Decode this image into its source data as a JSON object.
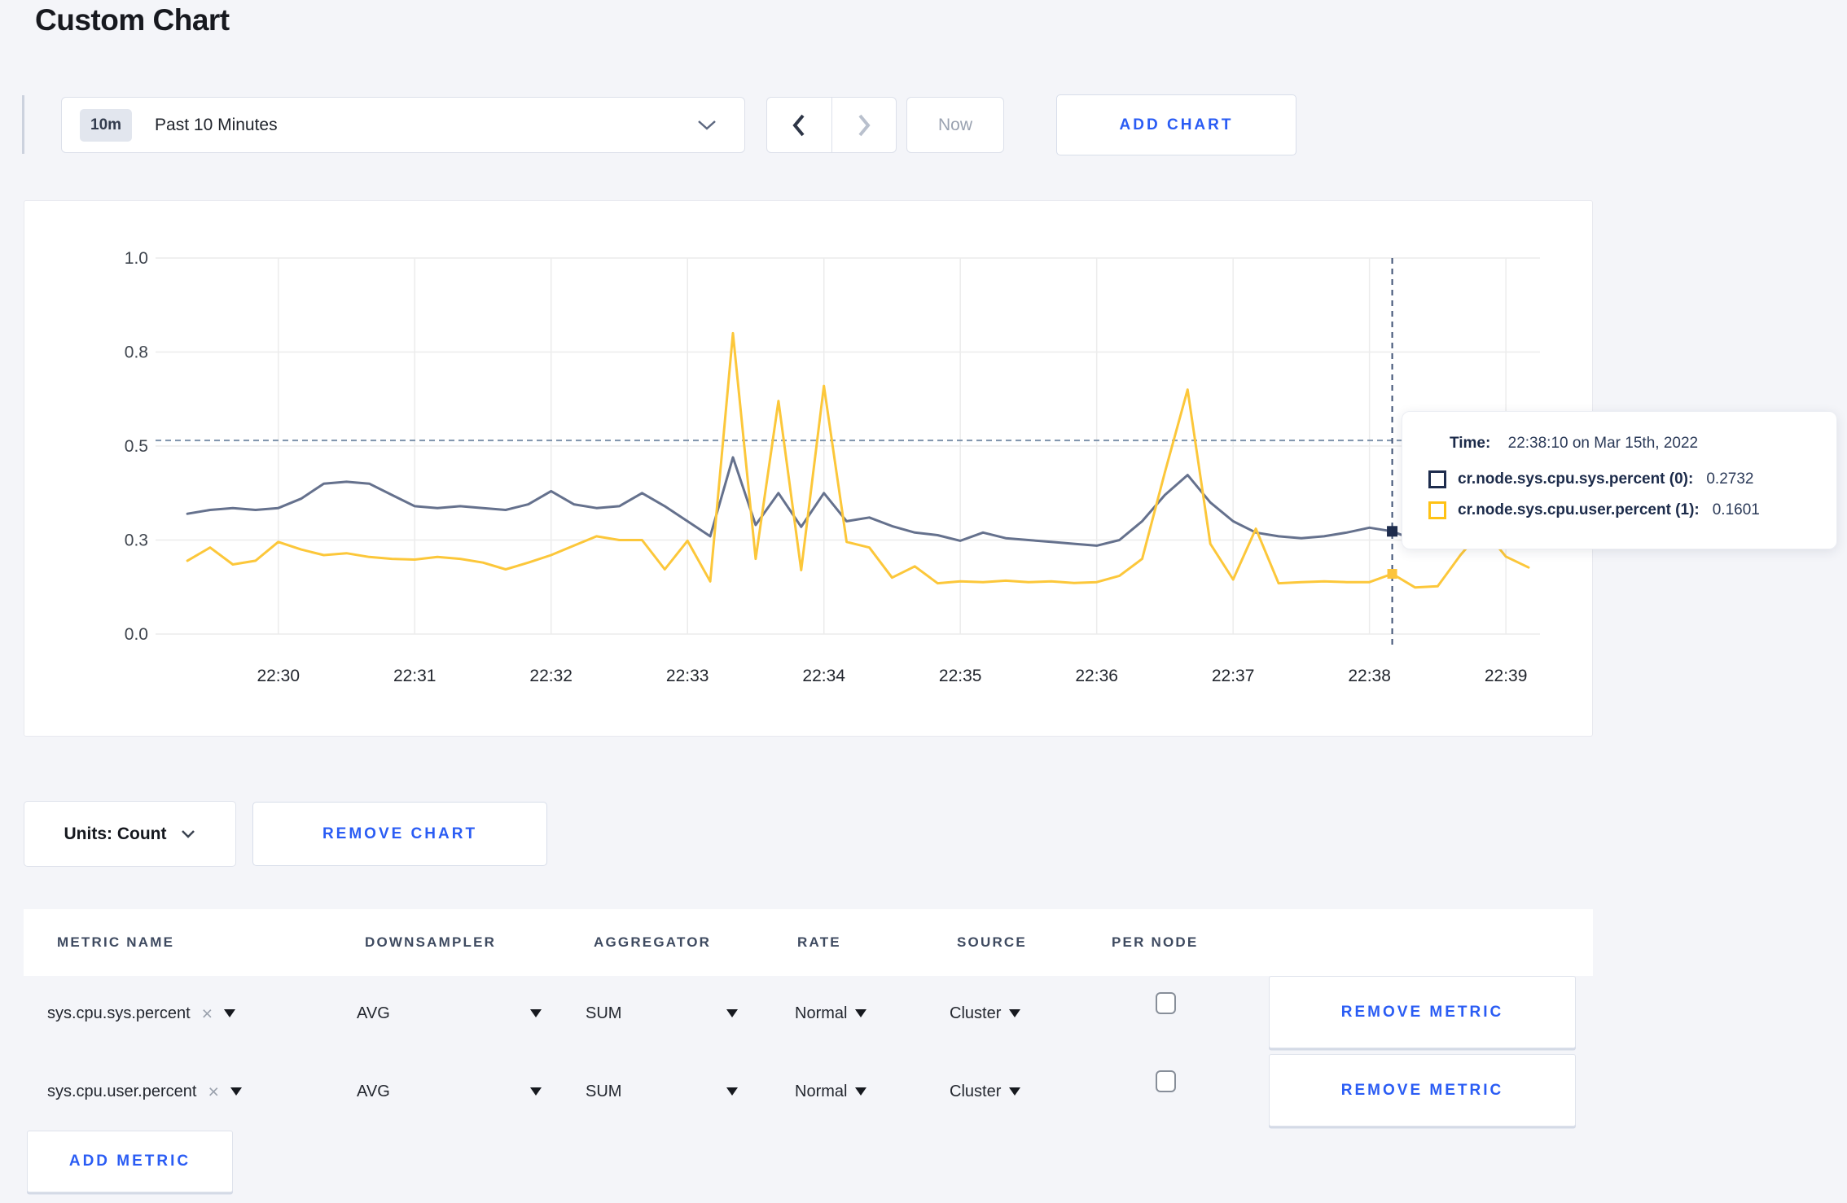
{
  "page": {
    "title": "Custom Chart",
    "background": "#f4f5f9",
    "accent_blue": "#2a5cf4"
  },
  "icons": {
    "close": "×"
  },
  "toolbar": {
    "time_selector": {
      "badge": "10m",
      "label": "Past 10 Minutes"
    },
    "now_label": "Now",
    "add_chart_label": "ADD CHART"
  },
  "tooltip": {
    "time_label": "Time:",
    "time_value": "22:38:10 on Mar 15th, 2022",
    "series": [
      {
        "name": "cr.node.sys.cpu.sys.percent (0):",
        "value": "0.2732",
        "color": "#1e2c4d"
      },
      {
        "name": "cr.node.sys.cpu.user.percent (1):",
        "value": "0.1601",
        "color": "#ffc215"
      }
    ]
  },
  "units_bar": {
    "units_label": "Units: Count",
    "remove_chart_label": "REMOVE CHART"
  },
  "metrics_table": {
    "headers": [
      "METRIC NAME",
      "DOWNSAMPLER",
      "AGGREGATOR",
      "RATE",
      "SOURCE",
      "PER NODE"
    ],
    "rows": [
      {
        "metric": "sys.cpu.sys.percent",
        "downsampler": "AVG",
        "aggregator": "SUM",
        "rate": "Normal",
        "source": "Cluster",
        "per_node_checked": false,
        "remove_label": "REMOVE METRIC"
      },
      {
        "metric": "sys.cpu.user.percent",
        "downsampler": "AVG",
        "aggregator": "SUM",
        "rate": "Normal",
        "source": "Cluster",
        "per_node_checked": false,
        "remove_label": "REMOVE METRIC"
      }
    ],
    "add_metric_label": "ADD METRIC"
  },
  "chart_data": {
    "type": "line",
    "title": "",
    "xlabel": "",
    "ylabel": "",
    "ylim": [
      0,
      1
    ],
    "grid": true,
    "legend": "tooltip-only",
    "x_domain": [
      "22:29:06",
      "22:39:15"
    ],
    "x_ticks": [
      "22:30",
      "22:31",
      "22:32",
      "22:33",
      "22:34",
      "22:35",
      "22:36",
      "22:37",
      "22:38",
      "22:39"
    ],
    "y_ticks": [
      {
        "pos": 0,
        "label": "0.0"
      },
      {
        "pos": 0.25,
        "label": "0.3"
      },
      {
        "pos": 0.5,
        "label": "0.5"
      },
      {
        "pos": 0.75,
        "label": "0.8"
      },
      {
        "pos": 1,
        "label": "1.0"
      }
    ],
    "dashed_hline_value": 0.515,
    "crosshair_time": "22:38:10",
    "x": [
      "22:29:20",
      "22:29:30",
      "22:29:40",
      "22:29:50",
      "22:30:00",
      "22:30:10",
      "22:30:20",
      "22:30:30",
      "22:30:40",
      "22:30:50",
      "22:31:00",
      "22:31:10",
      "22:31:20",
      "22:31:30",
      "22:31:40",
      "22:31:50",
      "22:32:00",
      "22:32:10",
      "22:32:20",
      "22:32:30",
      "22:32:40",
      "22:32:50",
      "22:33:00",
      "22:33:10",
      "22:33:20",
      "22:33:30",
      "22:33:40",
      "22:33:50",
      "22:34:00",
      "22:34:10",
      "22:34:20",
      "22:34:30",
      "22:34:40",
      "22:34:50",
      "22:35:00",
      "22:35:10",
      "22:35:20",
      "22:35:30",
      "22:35:40",
      "22:35:50",
      "22:36:00",
      "22:36:10",
      "22:36:20",
      "22:36:30",
      "22:36:40",
      "22:36:50",
      "22:37:00",
      "22:37:10",
      "22:37:20",
      "22:37:30",
      "22:37:40",
      "22:37:50",
      "22:38:00",
      "22:38:10",
      "22:38:20",
      "22:38:30",
      "22:38:40",
      "22:38:50",
      "22:39:00",
      "22:39:10"
    ],
    "series": [
      {
        "name": "cr.node.sys.cpu.sys.percent",
        "color": "#65718d",
        "values": [
          0.32,
          0.33,
          0.335,
          0.33,
          0.335,
          0.36,
          0.4,
          0.405,
          0.4,
          0.37,
          0.34,
          0.335,
          0.34,
          0.335,
          0.33,
          0.345,
          0.38,
          0.345,
          0.335,
          0.34,
          0.375,
          0.34,
          0.3,
          0.26,
          0.47,
          0.29,
          0.375,
          0.285,
          0.375,
          0.3,
          0.31,
          0.287,
          0.27,
          0.263,
          0.248,
          0.27,
          0.255,
          0.25,
          0.245,
          0.24,
          0.235,
          0.25,
          0.3,
          0.37,
          0.423,
          0.35,
          0.3,
          0.27,
          0.26,
          0.255,
          0.26,
          0.27,
          0.283,
          0.2732,
          0.25,
          0.262,
          0.27,
          0.272,
          0.27,
          0.272
        ]
      },
      {
        "name": "cr.node.sys.cpu.user.percent",
        "color": "#fcc73a",
        "values": [
          0.195,
          0.23,
          0.185,
          0.195,
          0.245,
          0.225,
          0.21,
          0.215,
          0.205,
          0.2,
          0.198,
          0.205,
          0.2,
          0.19,
          0.172,
          0.19,
          0.21,
          0.235,
          0.26,
          0.25,
          0.25,
          0.172,
          0.248,
          0.14,
          0.8,
          0.2,
          0.62,
          0.17,
          0.66,
          0.245,
          0.23,
          0.15,
          0.18,
          0.135,
          0.14,
          0.138,
          0.142,
          0.138,
          0.14,
          0.136,
          0.138,
          0.155,
          0.2,
          0.43,
          0.65,
          0.24,
          0.145,
          0.28,
          0.135,
          0.138,
          0.14,
          0.138,
          0.138,
          0.1601,
          0.124,
          0.127,
          0.21,
          0.28,
          0.206,
          0.177
        ]
      }
    ],
    "crosshair_markers": [
      {
        "series": 0,
        "value": 0.2732,
        "color": "#1e2c4d",
        "size": 13
      },
      {
        "series": 1,
        "value": 0.1601,
        "color": "#fcc43c",
        "size": 12
      }
    ]
  }
}
